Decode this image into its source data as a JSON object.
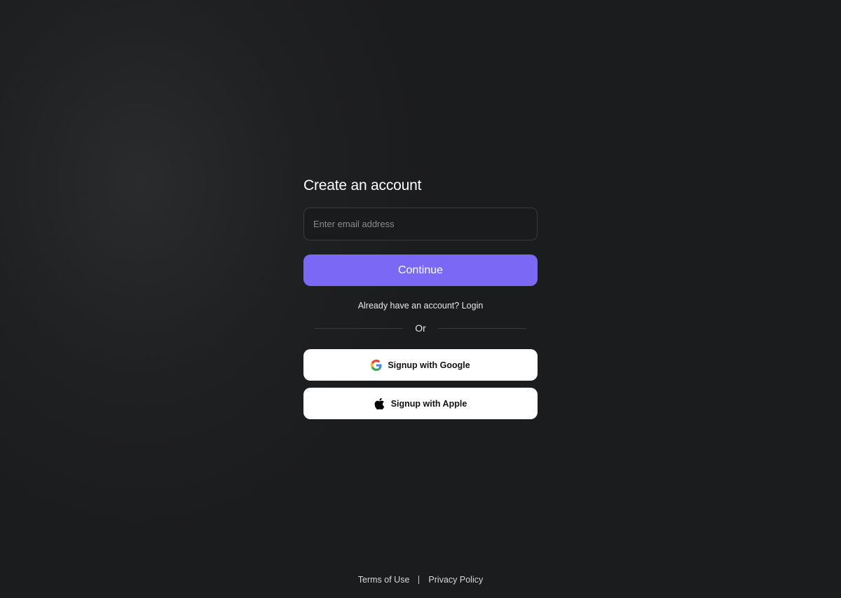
{
  "signup": {
    "title": "Create an account",
    "email_placeholder": "Enter email address",
    "email_value": "",
    "continue_label": "Continue",
    "login_prompt": "Already have an account? ",
    "login_link": "Login",
    "divider_text": "Or",
    "google_label": "Signup with Google",
    "apple_label": "Signup with Apple",
    "google_icon": "google-logo-icon",
    "apple_icon": "apple-logo-icon"
  },
  "footer": {
    "terms_label": "Terms of Use",
    "privacy_label": "Privacy Policy"
  },
  "colors": {
    "background": "#1b1c1e",
    "accent": "#7b68f5",
    "social_button_bg": "#ffffff"
  }
}
